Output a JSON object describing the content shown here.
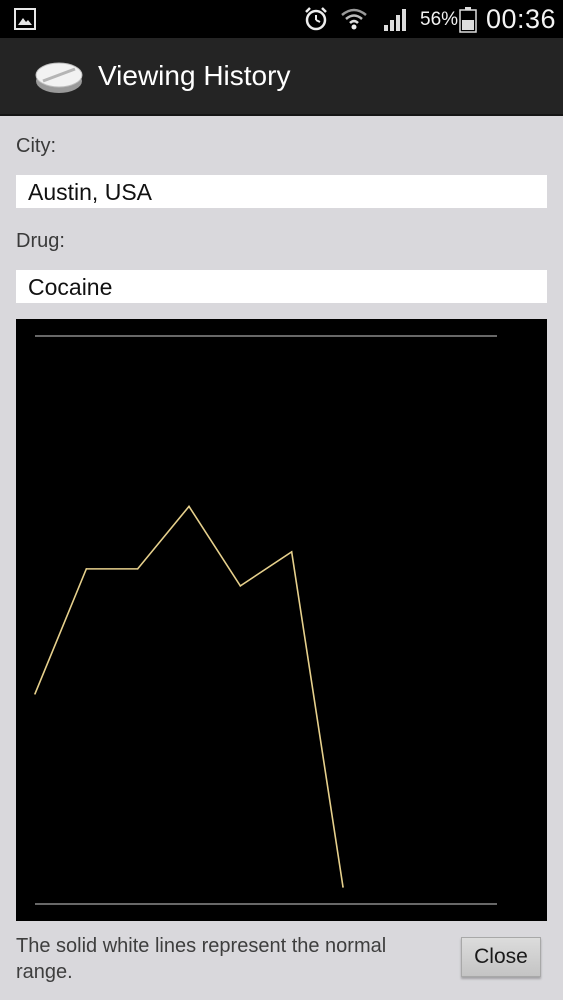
{
  "status_bar": {
    "battery_percent": "56%",
    "time": "00:36",
    "icons": [
      "gallery-icon",
      "alarm-icon",
      "wifi-icon",
      "signal-icon",
      "battery-icon"
    ]
  },
  "action_bar": {
    "title": "Viewing History",
    "icon": "pill-icon"
  },
  "form": {
    "city_label": "City:",
    "city_value": "Austin, USA",
    "drug_label": "Drug:",
    "drug_value": "Cocaine"
  },
  "chart_data": {
    "type": "line",
    "title": "",
    "xlabel": "",
    "ylabel": "",
    "x": [
      0,
      1,
      2,
      3,
      4,
      5,
      6
    ],
    "values": [
      0.37,
      0.59,
      0.59,
      0.7,
      0.56,
      0.62,
      0.03
    ],
    "ylim": [
      0,
      1
    ],
    "xlim": [
      0,
      9
    ],
    "normal_range": [
      0,
      1
    ],
    "line_color": "#e6d08c",
    "range_line_color": "#cfcfcf",
    "background": "#000000",
    "grid": false
  },
  "footer": {
    "note": "The solid white lines represent the normal range.",
    "close_label": "Close"
  }
}
